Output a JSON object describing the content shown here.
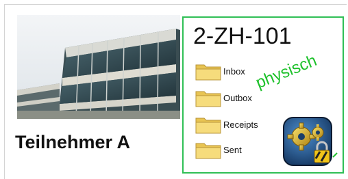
{
  "person": {
    "label": "Teilnehmer A"
  },
  "mailbox": {
    "id": "2-ZH-101",
    "stamp": "physisch",
    "folders": [
      {
        "label": "Inbox"
      },
      {
        "label": "Outbox"
      },
      {
        "label": "Receipts"
      },
      {
        "label": "Sent"
      }
    ]
  },
  "colors": {
    "frame": "#2fbf55",
    "stamp": "#1fc12c",
    "folder": "#f2d46a"
  },
  "icons": {
    "photo": "office-building-photo",
    "app": "gears-lock-icon",
    "folder": "folder-icon"
  }
}
